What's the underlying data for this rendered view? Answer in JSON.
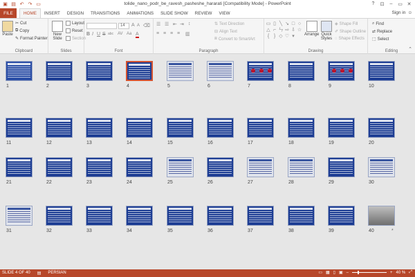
{
  "titlebar": {
    "title": "tolide_nano_podr_be_ravesh_pasheshe_hararati [Compatibility Mode] - PowerPoint",
    "help": "?",
    "minimize": "–",
    "restore": "▭",
    "close": "✕"
  },
  "tabs": {
    "file": "FILE",
    "items": [
      "HOME",
      "INSERT",
      "DESIGN",
      "TRANSITIONS",
      "ANIMATIONS",
      "SLIDE SHOW",
      "REVIEW",
      "VIEW"
    ],
    "active": "HOME",
    "signin": "Sign in"
  },
  "ribbon": {
    "clipboard": {
      "label": "Clipboard",
      "paste": "Paste",
      "cut": "Cut",
      "copy": "Copy",
      "format_painter": "Format Painter"
    },
    "slides": {
      "label": "Slides",
      "new_slide": "New Slide",
      "layout": "Layout",
      "reset": "Reset",
      "section": "Section"
    },
    "font": {
      "label": "Font",
      "font_name": "",
      "font_size": "14",
      "bold": "B",
      "italic": "I",
      "underline": "U",
      "strike": "S",
      "shadow": "abc",
      "char_spacing": "AV",
      "case": "Aa",
      "color": "A"
    },
    "paragraph": {
      "label": "Paragraph",
      "text_direction": "Text Direction",
      "align_text": "Align Text",
      "convert_smartart": "Convert to SmartArt"
    },
    "drawing": {
      "label": "Drawing",
      "arrange": "Arrange",
      "quick_styles": "Quick Styles",
      "shape_fill": "Shape Fill",
      "shape_outline": "Shape Outline",
      "shape_effects": "Shape Effects"
    },
    "editing": {
      "label": "Editing",
      "find": "Find",
      "replace": "Replace",
      "select": "Select"
    }
  },
  "slides": [
    {
      "n": "1",
      "kind": "title"
    },
    {
      "n": "2",
      "kind": "blue"
    },
    {
      "n": "3",
      "kind": "blue"
    },
    {
      "n": "4",
      "kind": "blue",
      "selected": true
    },
    {
      "n": "5",
      "kind": "light"
    },
    {
      "n": "6",
      "kind": "light"
    },
    {
      "n": "7",
      "kind": "blue"
    },
    {
      "n": "8",
      "kind": "blue"
    },
    {
      "n": "9",
      "kind": "blue"
    },
    {
      "n": "10",
      "kind": "blue"
    },
    {
      "n": "11",
      "kind": "blue"
    },
    {
      "n": "12",
      "kind": "blue"
    },
    {
      "n": "13",
      "kind": "blue"
    },
    {
      "n": "14",
      "kind": "blue"
    },
    {
      "n": "15",
      "kind": "blue"
    },
    {
      "n": "16",
      "kind": "blue"
    },
    {
      "n": "17",
      "kind": "blue"
    },
    {
      "n": "18",
      "kind": "blue"
    },
    {
      "n": "19",
      "kind": "blue"
    },
    {
      "n": "20",
      "kind": "blue"
    },
    {
      "n": "21",
      "kind": "blue"
    },
    {
      "n": "22",
      "kind": "blue"
    },
    {
      "n": "23",
      "kind": "blue"
    },
    {
      "n": "24",
      "kind": "blue"
    },
    {
      "n": "25",
      "kind": "light"
    },
    {
      "n": "26",
      "kind": "blue"
    },
    {
      "n": "27",
      "kind": "light"
    },
    {
      "n": "28",
      "kind": "light"
    },
    {
      "n": "29",
      "kind": "blue"
    },
    {
      "n": "30",
      "kind": "light"
    },
    {
      "n": "31",
      "kind": "light"
    },
    {
      "n": "32",
      "kind": "blue"
    },
    {
      "n": "33",
      "kind": "blue"
    },
    {
      "n": "34",
      "kind": "blue"
    },
    {
      "n": "35",
      "kind": "blue"
    },
    {
      "n": "36",
      "kind": "blue"
    },
    {
      "n": "37",
      "kind": "blue"
    },
    {
      "n": "38",
      "kind": "blue"
    },
    {
      "n": "39",
      "kind": "blue"
    },
    {
      "n": "40",
      "kind": "photo"
    }
  ],
  "star": "*",
  "status": {
    "slide_info": "SLIDE 4 OF 40",
    "language": "PERSIAN",
    "zoom_out": "–",
    "zoom_in": "+",
    "zoom": "40 %",
    "zoom_level_pct": 40
  },
  "colors": {
    "accent": "#b7472a",
    "slide_blue": "#1e3e94",
    "selection": "#d35230"
  }
}
